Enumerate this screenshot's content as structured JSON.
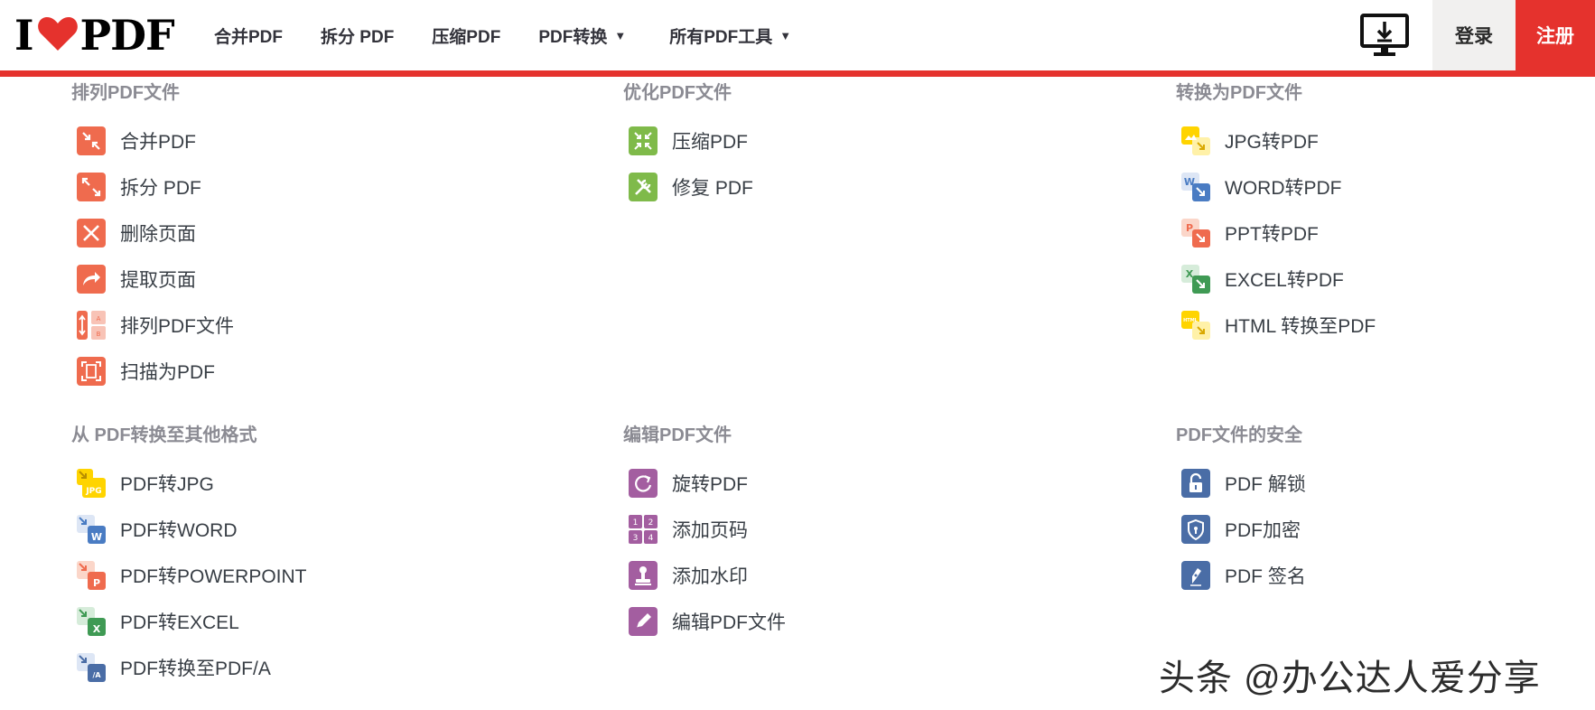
{
  "header": {
    "logo_left": "I",
    "logo_right": "PDF",
    "nav": [
      {
        "label": "合并PDF",
        "caret": false
      },
      {
        "label": "拆分 PDF",
        "caret": false
      },
      {
        "label": "压缩PDF",
        "caret": false
      },
      {
        "label": "PDF转换",
        "caret": true
      },
      {
        "label": "所有PDF工具",
        "caret": true
      }
    ],
    "caret_glyph": "▼",
    "login_label": "登录",
    "signup_label": "注册",
    "desktop_icon": "desktop-download-icon"
  },
  "colors": {
    "brand_red": "#e5322d",
    "organize": "#ef6b4e",
    "optimize": "#7fba4a",
    "jpg_yellow": "#ffd400",
    "word_blue": "#4a7cc3",
    "excel_green": "#3f9a54",
    "edit_purple": "#a35ea0",
    "security_blue": "#4a6da6"
  },
  "sections": [
    {
      "title": "排列PDF文件",
      "items": [
        {
          "label": "合并PDF",
          "icon": "merge-icon"
        },
        {
          "label": "拆分 PDF",
          "icon": "split-icon"
        },
        {
          "label": "删除页面",
          "icon": "remove-pages-icon"
        },
        {
          "label": "提取页面",
          "icon": "extract-pages-icon"
        },
        {
          "label": "排列PDF文件",
          "icon": "organize-icon"
        },
        {
          "label": "扫描为PDF",
          "icon": "scan-icon"
        }
      ]
    },
    {
      "title": "优化PDF文件",
      "items": [
        {
          "label": "压缩PDF",
          "icon": "compress-icon"
        },
        {
          "label": "修复 PDF",
          "icon": "repair-icon"
        }
      ]
    },
    {
      "title": "转换为PDF文件",
      "items": [
        {
          "label": "JPG转PDF",
          "icon": "jpg-to-pdf-icon"
        },
        {
          "label": "WORD转PDF",
          "icon": "word-to-pdf-icon"
        },
        {
          "label": "PPT转PDF",
          "icon": "ppt-to-pdf-icon"
        },
        {
          "label": "EXCEL转PDF",
          "icon": "excel-to-pdf-icon"
        },
        {
          "label": "HTML 转换至PDF",
          "icon": "html-to-pdf-icon"
        }
      ]
    },
    {
      "title": "从 PDF转换至其他格式",
      "items": [
        {
          "label": "PDF转JPG",
          "icon": "pdf-to-jpg-icon"
        },
        {
          "label": "PDF转WORD",
          "icon": "pdf-to-word-icon"
        },
        {
          "label": "PDF转POWERPOINT",
          "icon": "pdf-to-ppt-icon"
        },
        {
          "label": "PDF转EXCEL",
          "icon": "pdf-to-excel-icon"
        },
        {
          "label": "PDF转换至PDF/A",
          "icon": "pdf-to-pdfa-icon"
        }
      ]
    },
    {
      "title": "编辑PDF文件",
      "items": [
        {
          "label": "旋转PDF",
          "icon": "rotate-icon"
        },
        {
          "label": "添加页码",
          "icon": "page-numbers-icon"
        },
        {
          "label": "添加水印",
          "icon": "watermark-icon"
        },
        {
          "label": "编辑PDF文件",
          "icon": "edit-icon"
        }
      ]
    },
    {
      "title": "PDF文件的安全",
      "items": [
        {
          "label": "PDF 解锁",
          "icon": "unlock-icon"
        },
        {
          "label": "PDF加密",
          "icon": "protect-icon"
        },
        {
          "label": "PDF 签名",
          "icon": "sign-icon"
        }
      ]
    }
  ],
  "watermark_text": "头条 @办公达人爱分享"
}
